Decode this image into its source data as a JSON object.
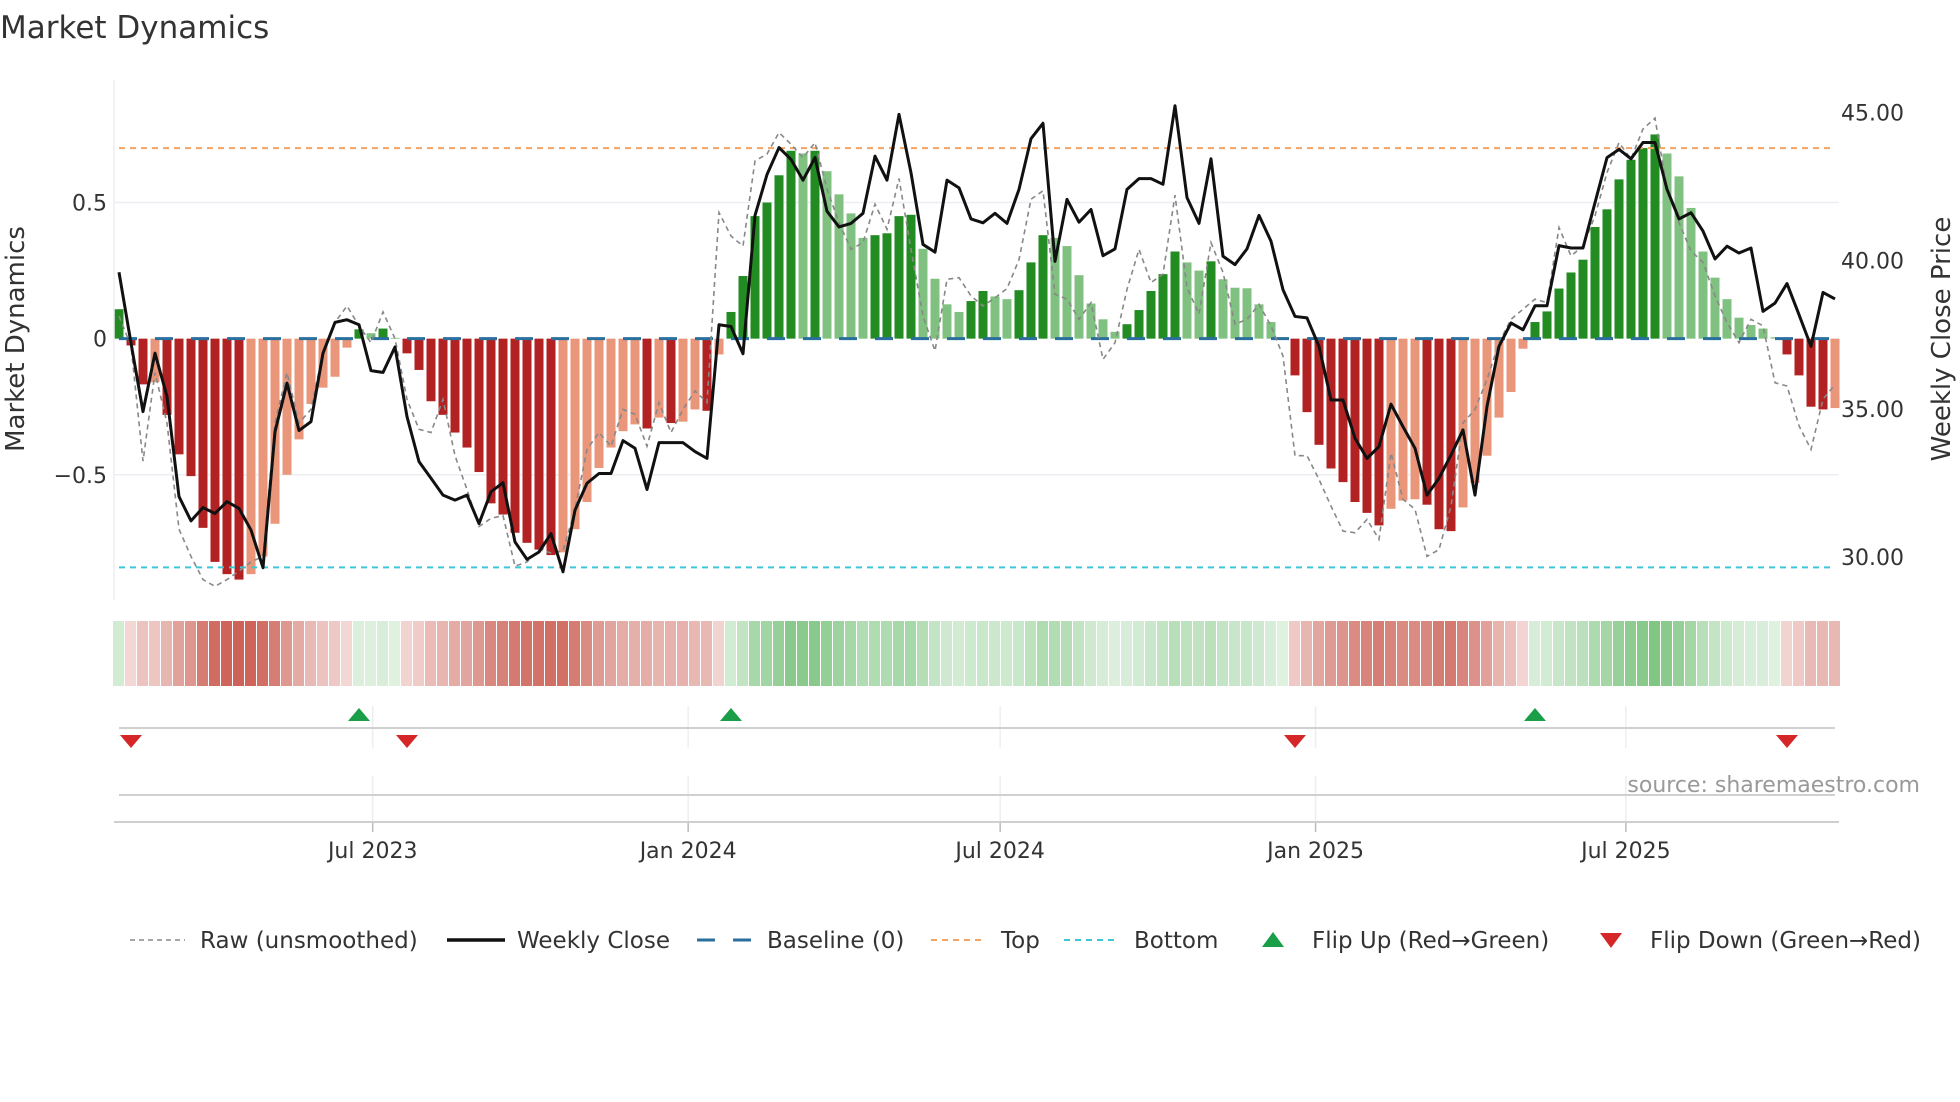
{
  "title": "Market Dynamics",
  "source": "source: sharemaestro.com",
  "chart_data": {
    "type": "bar",
    "title": "Market Dynamics",
    "ylabel": "Market Dynamics",
    "y2label": "Weekly Close Price",
    "ylim": [
      -0.96,
      0.95
    ],
    "y2lim": [
      28.55,
      46.1
    ],
    "yticks": [
      {
        "value": 0.5,
        "label": "0.5"
      },
      {
        "value": 0,
        "label": "0"
      },
      {
        "value": -0.5,
        "label": "−0.5"
      }
    ],
    "y2ticks": [
      {
        "value": 45,
        "label": "45.00"
      },
      {
        "value": 40,
        "label": "40.00"
      },
      {
        "value": 35,
        "label": "35.00"
      },
      {
        "value": 30,
        "label": "30.00"
      }
    ],
    "xticks": [
      {
        "date": "2023-07-01",
        "label": "Jul 2023"
      },
      {
        "date": "2024-01-01",
        "label": "Jan 2024"
      },
      {
        "date": "2024-07-01",
        "label": "Jul 2024"
      },
      {
        "date": "2025-01-01",
        "label": "Jan 2025"
      },
      {
        "date": "2025-07-01",
        "label": "Jul 2025"
      }
    ],
    "start_date": "2023-02-03",
    "frequency": "weekly",
    "top_level": 0.7,
    "bottom_level": -0.84,
    "baseline": 0,
    "grid": true,
    "legend_position": "bottom",
    "colors": {
      "green_rising": "#228b22",
      "green_falling": "#80c080",
      "red_falling": "#b22222",
      "red_rising": "#e9967a",
      "top": "#f4a460",
      "bottom": "#3cc8d8",
      "baseline": "#2a6f9e",
      "raw": "#888888",
      "close": "#111111",
      "flip_up": "#1a9e48",
      "flip_down": "#d62728",
      "strip_green": "#4caf50",
      "strip_red": "#c0392b"
    },
    "series": [
      {
        "name": "Market Dynamics",
        "values": [
          0.108,
          -0.025,
          -0.168,
          -0.16,
          -0.28,
          -0.425,
          -0.505,
          -0.695,
          -0.82,
          -0.865,
          -0.885,
          -0.865,
          -0.8,
          -0.68,
          -0.5,
          -0.37,
          -0.24,
          -0.18,
          -0.14,
          -0.033,
          0.034,
          0.02,
          0.037,
          0.003,
          -0.054,
          -0.115,
          -0.23,
          -0.28,
          -0.345,
          -0.4,
          -0.49,
          -0.605,
          -0.646,
          -0.713,
          -0.75,
          -0.775,
          -0.795,
          -0.785,
          -0.7,
          -0.6,
          -0.475,
          -0.4,
          -0.34,
          -0.315,
          -0.33,
          -0.29,
          -0.31,
          -0.305,
          -0.26,
          -0.265,
          -0.058,
          0.098,
          0.23,
          0.45,
          0.5,
          0.6,
          0.69,
          0.68,
          0.69,
          0.615,
          0.53,
          0.46,
          0.37,
          0.38,
          0.387,
          0.45,
          0.455,
          0.33,
          0.22,
          0.126,
          0.098,
          0.138,
          0.175,
          0.155,
          0.145,
          0.178,
          0.28,
          0.38,
          0.37,
          0.34,
          0.233,
          0.129,
          0.071,
          0.025,
          0.053,
          0.105,
          0.175,
          0.237,
          0.32,
          0.28,
          0.25,
          0.284,
          0.218,
          0.187,
          0.185,
          0.126,
          0.061,
          0.005,
          -0.135,
          -0.27,
          -0.39,
          -0.477,
          -0.527,
          -0.6,
          -0.64,
          -0.686,
          -0.625,
          -0.595,
          -0.59,
          -0.61,
          -0.7,
          -0.707,
          -0.62,
          -0.53,
          -0.43,
          -0.29,
          -0.196,
          -0.037,
          0.061,
          0.1,
          0.184,
          0.243,
          0.29,
          0.41,
          0.475,
          0.585,
          0.657,
          0.7,
          0.75,
          0.68,
          0.596,
          0.48,
          0.32,
          0.224,
          0.145,
          0.077,
          0.05,
          0.037,
          0.005,
          -0.058,
          -0.135,
          -0.25,
          -0.26,
          -0.255
        ]
      },
      {
        "name": "Raw (unsmoothed)",
        "values": [
          0.083,
          -0.027,
          -0.45,
          -0.125,
          -0.31,
          -0.7,
          -0.8,
          -0.885,
          -0.91,
          -0.885,
          -0.854,
          -0.82,
          -0.8,
          -0.31,
          -0.125,
          -0.31,
          -0.26,
          -0.05,
          0.06,
          0.12,
          0.047,
          -0.015,
          0.098,
          0,
          -0.223,
          -0.333,
          -0.345,
          -0.223,
          -0.43,
          -0.554,
          -0.69,
          -0.66,
          -0.65,
          -0.836,
          -0.82,
          -0.775,
          -0.787,
          -0.78,
          -0.627,
          -0.407,
          -0.345,
          -0.395,
          -0.26,
          -0.278,
          -0.395,
          -0.235,
          -0.345,
          -0.26,
          -0.192,
          -0.235,
          0.463,
          0.377,
          0.34,
          0.653,
          0.678,
          0.757,
          0.714,
          0.665,
          0.72,
          0.55,
          0.426,
          0.328,
          0.353,
          0.494,
          0.402,
          0.588,
          0.328,
          0.083,
          -0.045,
          0.218,
          0.224,
          0.157,
          0.12,
          0.15,
          0.184,
          0.29,
          0.512,
          0.543,
          0.163,
          0.145,
          0.071,
          0.132,
          -0.076,
          -0.015,
          0.181,
          0.328,
          0.206,
          0.237,
          0.527,
          0.188,
          0.09,
          0.353,
          0.243,
          0.053,
          0.071,
          0.126,
          0.047,
          -0.064,
          -0.43,
          -0.43,
          -0.517,
          -0.615,
          -0.707,
          -0.713,
          -0.664,
          -0.737,
          -0.42,
          -0.59,
          -0.627,
          -0.8,
          -0.775,
          -0.615,
          -0.31,
          -0.26,
          -0.15,
          -0.015,
          0.071,
          0.108,
          0.145,
          0.132,
          0.408,
          0.304,
          0.34,
          0.451,
          0.61,
          0.72,
          0.66,
          0.77,
          0.81,
          0.55,
          0.426,
          0.322,
          0.28,
          0.157,
          0.059,
          -0.015,
          0.071,
          0.047,
          -0.162,
          -0.174,
          -0.32,
          -0.407,
          -0.223,
          -0.168
        ]
      },
      {
        "name": "Weekly Close",
        "axis": "right",
        "values": [
          39.61,
          37.22,
          34.91,
          36.88,
          35.42,
          32.04,
          31.22,
          31.67,
          31.47,
          31.87,
          31.64,
          30.91,
          29.64,
          34.23,
          35.87,
          34.27,
          34.57,
          36.88,
          37.92,
          38.01,
          37.84,
          36.29,
          36.23,
          37.09,
          34.74,
          33.22,
          32.66,
          32.09,
          31.92,
          32.09,
          31.13,
          32.2,
          32.51,
          30.51,
          29.92,
          30.17,
          30.79,
          29.5,
          31.58,
          32.49,
          32.82,
          32.82,
          33.93,
          33.67,
          32.28,
          33.86,
          33.86,
          33.86,
          33.56,
          33.33,
          37.84,
          37.78,
          36.86,
          41.53,
          42.91,
          43.82,
          43.42,
          42.72,
          43.48,
          41.67,
          41.14,
          41.26,
          41.6,
          43.53,
          42.72,
          44.94,
          42.97,
          40.55,
          40.29,
          42.72,
          42.46,
          41.41,
          41.28,
          41.6,
          41.26,
          42.41,
          44.12,
          44.64,
          39.98,
          42.07,
          41.3,
          41.73,
          40.17,
          40.4,
          42.41,
          42.77,
          42.77,
          42.58,
          45.23,
          42.13,
          41.26,
          43.44,
          40.15,
          39.87,
          40.4,
          41.53,
          40.66,
          39.02,
          38.12,
          38.07,
          37.11,
          35.3,
          35.3,
          34.01,
          33.33,
          33.73,
          35.16,
          34.4,
          33.67,
          32.09,
          32.66,
          33.44,
          34.29,
          32.09,
          35.08,
          37.11,
          37.9,
          37.67,
          38.48,
          38.48,
          40.51,
          40.43,
          40.43,
          41.96,
          43.48,
          43.76,
          43.44,
          43.99,
          43.99,
          42.41,
          41.41,
          41.62,
          41.0,
          40.06,
          40.49,
          40.26,
          40.43,
          38.29,
          38.57,
          39.23,
          38.18,
          37.11,
          38.93,
          38.71
        ]
      }
    ],
    "legend": [
      {
        "key": "raw",
        "label": "Raw (unsmoothed)"
      },
      {
        "key": "close",
        "label": "Weekly Close"
      },
      {
        "key": "baseline",
        "label": "Baseline (0)"
      },
      {
        "key": "top",
        "label": "Top"
      },
      {
        "key": "bottom",
        "label": "Bottom"
      },
      {
        "key": "flip_up",
        "label": "Flip Up (Red→Green)"
      },
      {
        "key": "flip_down",
        "label": "Flip Down (Green→Red)"
      }
    ]
  }
}
